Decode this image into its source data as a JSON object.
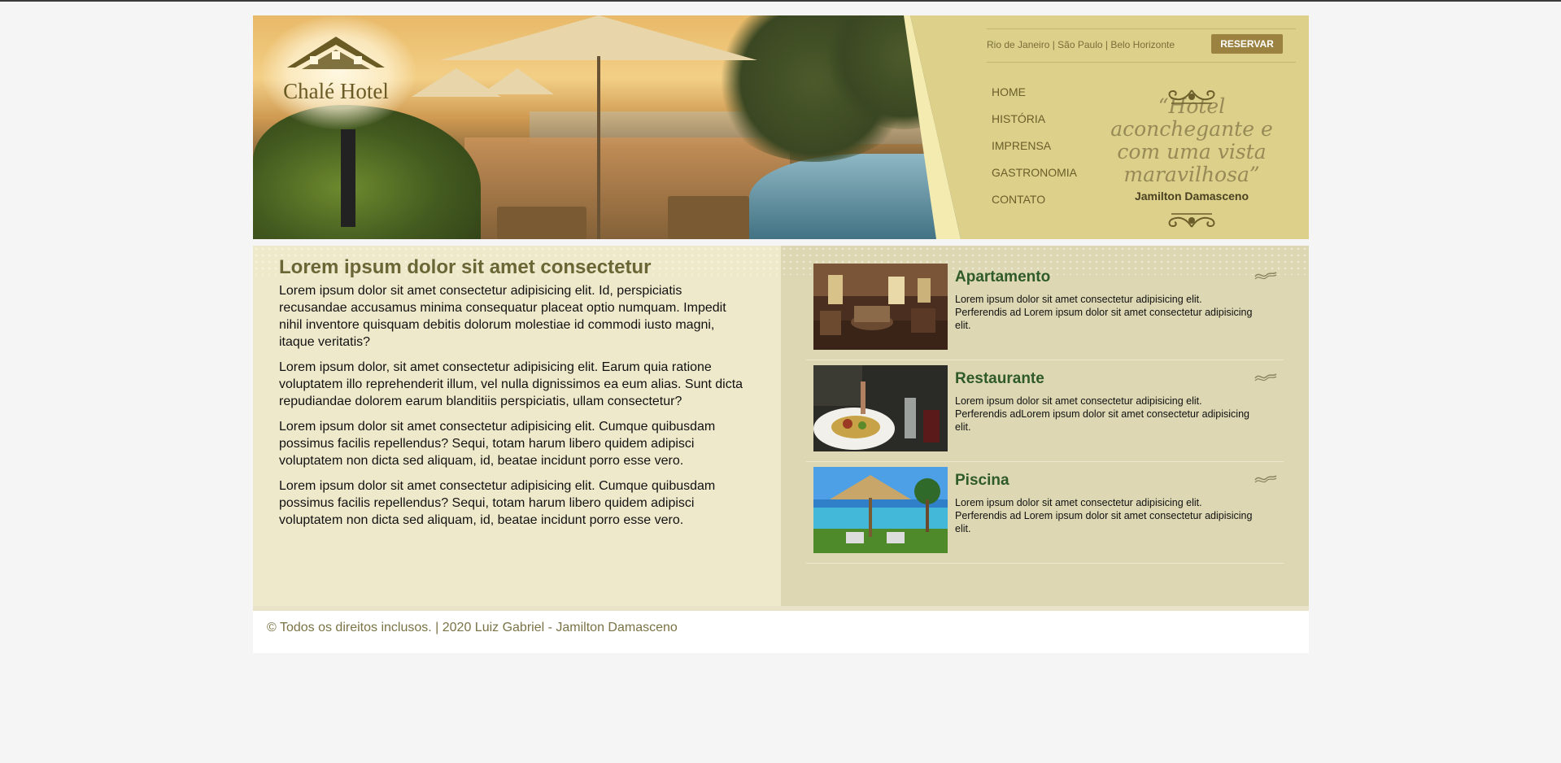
{
  "brand": {
    "name": "Chalé Hotel"
  },
  "header": {
    "cities": "Rio de Janeiro | São Paulo | Belo Horizonte",
    "reserve_label": "RESERVAR",
    "nav": [
      "HOME",
      "HISTÓRIA",
      "IMPRENSA",
      "GASTRONOMIA",
      "CONTATO"
    ],
    "quote": "“Hotel aconchegante e com uma vista maravilhosa”",
    "quote_author": "Jamilton Damasceno"
  },
  "main": {
    "title": "Lorem ipsum dolor sit amet consectetur",
    "paragraphs": [
      "Lorem ipsum dolor sit amet consectetur adipisicing elit. Id, perspiciatis recusandae accusamus minima consequatur placeat optio numquam. Impedit nihil inventore quisquam debitis dolorum molestiae id commodi iusto magni, itaque veritatis?",
      "Lorem ipsum dolor, sit amet consectetur adipisicing elit. Earum quia ratione voluptatem illo reprehenderit illum, vel nulla dignissimos ea eum alias. Sunt dicta repudiandae dolorem earum blanditiis perspiciatis, ullam consectetur?",
      "Lorem ipsum dolor sit amet consectetur adipisicing elit. Cumque quibusdam possimus facilis repellendus? Sequi, totam harum libero quidem adipisci voluptatem non dicta sed aliquam, id, beatae incidunt porro esse vero.",
      "Lorem ipsum dolor sit amet consectetur adipisicing elit. Cumque quibusdam possimus facilis repellendus? Sequi, totam harum libero quidem adipisci voluptatem non dicta sed aliquam, id, beatae incidunt porro esse vero."
    ]
  },
  "sidebar": {
    "items": [
      {
        "title": "Apartamento",
        "text": "Lorem ipsum dolor sit amet consectetur adipisicing elit. Perferendis ad Lorem ipsum dolor sit amet consectetur adipisicing elit.",
        "image": "room-photo"
      },
      {
        "title": "Restaurante",
        "text": "Lorem ipsum dolor sit amet consectetur adipisicing elit. Perferendis adLorem ipsum dolor sit amet consectetur adipisicing elit.",
        "image": "dining-photo"
      },
      {
        "title": "Piscina",
        "text": "Lorem ipsum dolor sit amet consectetur adipisicing elit. Perferendis ad Lorem ipsum dolor sit amet consectetur adipisicing elit.",
        "image": "pool-photo"
      }
    ]
  },
  "footer": {
    "text": "© Todos os direitos inclusos. | 2020 Luiz Gabriel - Jamilton Damasceno"
  },
  "colors": {
    "header_bg": "#ddd08a",
    "accent": "#9b8240",
    "title": "#6b6636",
    "item_title": "#2f5a2a"
  }
}
